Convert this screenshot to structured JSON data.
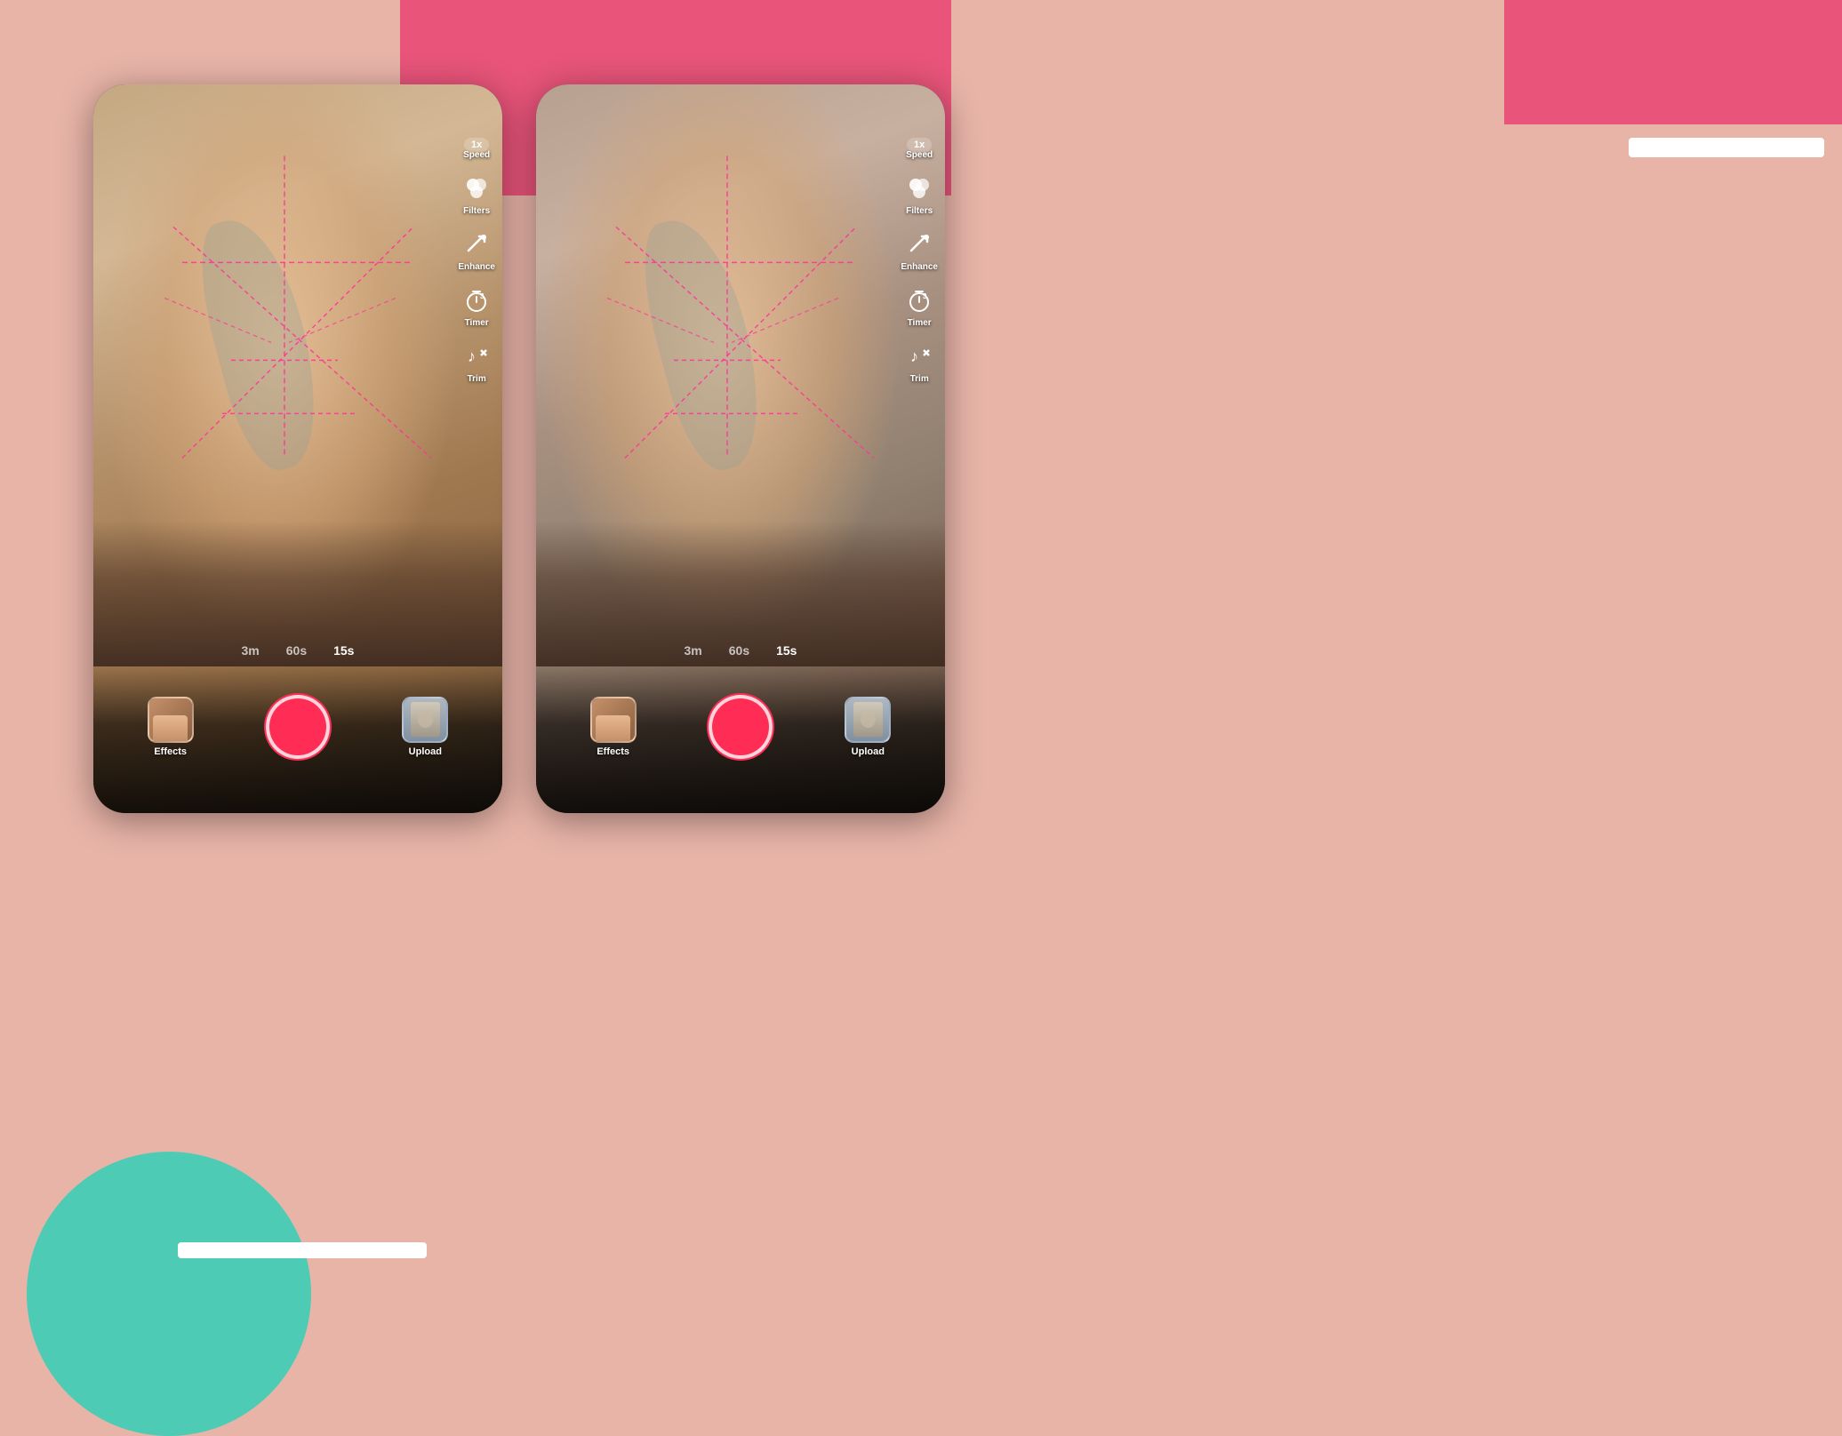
{
  "background": {
    "color": "#e8b4a8"
  },
  "phones": [
    {
      "id": "phone-left",
      "toolbar": {
        "speed": "1x",
        "speed_label": "Speed",
        "filters_label": "Filters",
        "enhance_label": "Enhance",
        "timer_label": "Timer",
        "timer_badge": "3",
        "trim_label": "Trim"
      },
      "duration_options": [
        "3m",
        "60s",
        "15s"
      ],
      "active_duration": "15s",
      "bottom": {
        "effects_label": "Effects",
        "upload_label": "Upload"
      }
    },
    {
      "id": "phone-right",
      "toolbar": {
        "speed": "1x",
        "speed_label": "Speed",
        "filters_label": "Filters",
        "enhance_label": "Enhance",
        "timer_label": "Timer",
        "timer_badge": "3",
        "trim_label": "Trim"
      },
      "duration_options": [
        "3m",
        "60s",
        "15s"
      ],
      "active_duration": "15s",
      "bottom": {
        "effects_label": "Effects",
        "upload_label": "Upload"
      }
    }
  ]
}
